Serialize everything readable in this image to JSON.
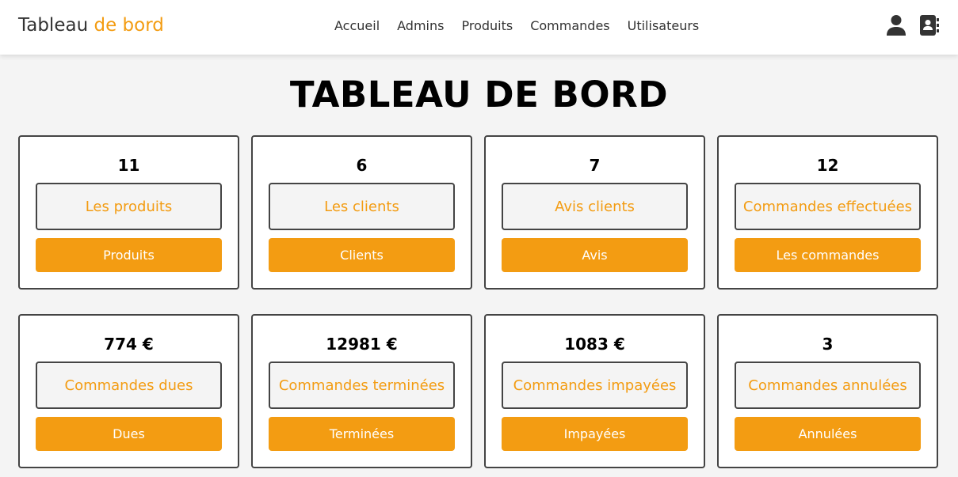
{
  "header": {
    "logo_main": "Tableau",
    "logo_accent": "de bord",
    "nav": [
      "Accueil",
      "Admins",
      "Produits",
      "Commandes",
      "Utilisateurs"
    ],
    "icons": [
      "user-icon",
      "contacts-book-icon"
    ]
  },
  "page_title": "TABLEAU DE BORD",
  "accent_color": "#f39c12",
  "cards": [
    {
      "count": "11",
      "label": "Les produits",
      "button": "Produits"
    },
    {
      "count": "6",
      "label": "Les clients",
      "button": "Clients"
    },
    {
      "count": "7",
      "label": "Avis clients",
      "button": "Avis"
    },
    {
      "count": "12",
      "label": "Commandes effectuées",
      "button": "Les commandes"
    },
    {
      "count": "774 €",
      "label": "Commandes dues",
      "button": "Dues"
    },
    {
      "count": "12981 €",
      "label": "Commandes terminées",
      "button": "Terminées"
    },
    {
      "count": "1083 €",
      "label": "Commandes impayées",
      "button": "Impayées"
    },
    {
      "count": "3",
      "label": "Commandes annulées",
      "button": "Annulées"
    }
  ]
}
